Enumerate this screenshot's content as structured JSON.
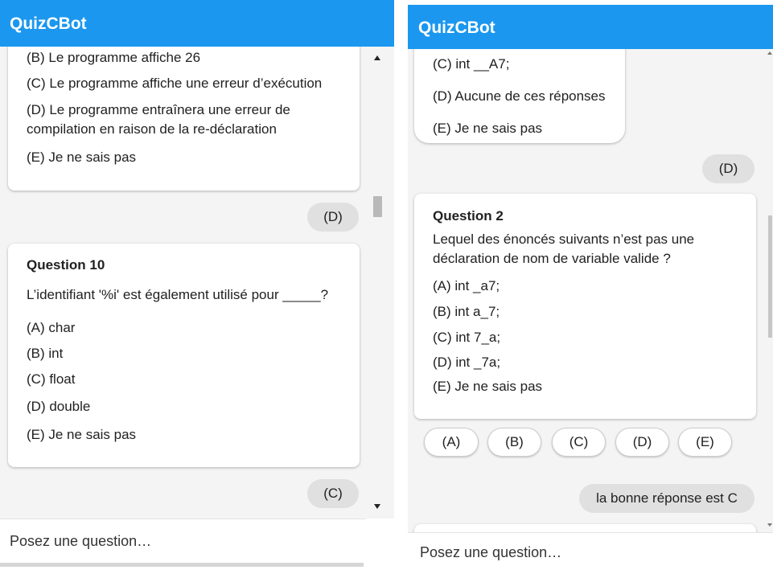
{
  "colors": {
    "header": "#1B97EF",
    "header_text": "#FFFFFF",
    "chat_background": "#F4F4F4",
    "card_background": "#FFFFFF",
    "user_bubble": "#E0E0E0",
    "text": "#212121"
  },
  "left_screen": {
    "header": {
      "title": "QuizCBot"
    },
    "previous_question": {
      "options": [
        "(B) Le programme affiche 26",
        "(C) Le programme affiche une erreur d’exécution",
        "(D) Le programme entraînera une erreur de compilation en raison de la re-déclaration",
        "(E) Je ne sais pas"
      ]
    },
    "user_answer_previous": "(D)",
    "question": {
      "title": "Question 10",
      "text": "L’identifiant '%i' est également utilisé pour _____?",
      "options": [
        "(A) char",
        "(B) int",
        "(C) float",
        "(D) double",
        "(E) Je ne sais pas"
      ]
    },
    "user_answer": "(C)",
    "input": {
      "placeholder": "Posez une question…"
    }
  },
  "right_screen": {
    "header": {
      "title": "QuizCBot"
    },
    "previous_question": {
      "options": [
        "(C) int __A7;",
        "(D) Aucune de ces réponses",
        "(E) Je ne sais pas"
      ]
    },
    "user_answer_previous": "(D)",
    "question": {
      "title": "Question 2",
      "text": "Lequel des énoncés suivants n’est pas une déclaration de nom de variable valide ?",
      "options": [
        "(A) int _a7;",
        "(B) int a_7;",
        "(C) int 7_a;",
        "(D) int _7a;",
        "(E) Je ne sais pas"
      ]
    },
    "answer_buttons": [
      "(A)",
      "(B)",
      "(C)",
      "(D)",
      "(E)"
    ],
    "user_answer": "la bonne réponse est C",
    "input": {
      "placeholder": "Posez une question…"
    }
  }
}
